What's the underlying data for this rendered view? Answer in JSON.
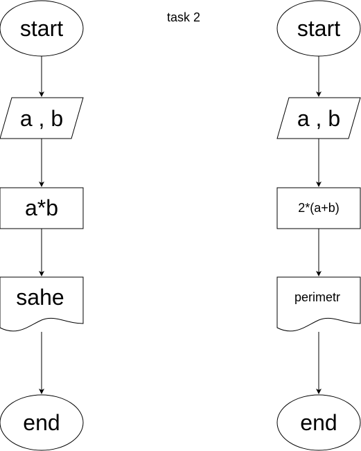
{
  "title": "task 2",
  "flowcharts": [
    {
      "start": "start",
      "input": "a , b",
      "process": "a*b",
      "output": "sahe",
      "end": "end"
    },
    {
      "start": "start",
      "input": "a , b",
      "process": "2*(a+b)",
      "output": "perimetr",
      "end": "end"
    }
  ]
}
